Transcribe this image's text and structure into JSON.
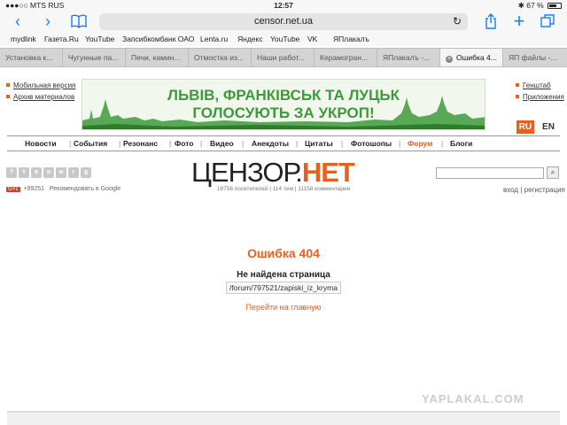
{
  "status": {
    "carrier": "●●●○○ MTS RUS",
    "time": "12:57",
    "bt": "✱",
    "battery_text": "67 %",
    "battery_level": 0.67
  },
  "browser": {
    "url": "censor.net.ua",
    "bookmarks": [
      "mydlink",
      "Газета.Ru",
      "YouTube",
      "Запсибкомбанк ОАО",
      "Lenta.ru",
      "Яндекс",
      "YouTube",
      "VK",
      "ЯПлакалъ"
    ],
    "tabs": [
      {
        "label": "Установка к..."
      },
      {
        "label": "Чугунные па..."
      },
      {
        "label": "Печи, камин..."
      },
      {
        "label": "Отмостка из..."
      },
      {
        "label": "Наши работ..."
      },
      {
        "label": "Керамогран..."
      },
      {
        "label": "ЯПлакалъ -..."
      },
      {
        "label": "Ошибка 4..."
      },
      {
        "label": "ЯП файлы -..."
      }
    ]
  },
  "site": {
    "mobile_version": "Мобильная версия",
    "archive": "Архив материалов",
    "genshtab": "Генштаб",
    "apps": "Приложения",
    "banner_line1": "ЛЬВІВ, ФРАНКІВСЬК ТА ЛУЦЬК",
    "banner_line2": "ГОЛОСУЮТЬ ЗА УКРОП!",
    "lang_ru": "RU",
    "lang_en": "EN",
    "nav": [
      "Новости",
      "События",
      "Резонанс",
      "Фото",
      "Видео",
      "Анекдоты",
      "Цитаты",
      "Фотошопы",
      "Форум",
      "Блоги"
    ],
    "logo_a": "ЦЕНЗОР.",
    "logo_b": "НЕТ",
    "stats": "16756 посетителей | 114 тем | 11158 комментария",
    "g1_label": "G+1",
    "g1_count": "+99251",
    "g1_text": "Рекомендовать в Google",
    "login": "вход",
    "register": "регистрация",
    "login_sep": "|"
  },
  "error": {
    "title": "Ошибка 404",
    "subtitle": "Не найдена страница",
    "path": "/forum/797521/zapiski_iz_kryma",
    "home_link": "Перейти на главную"
  },
  "watermark": "YAPLAKAL.COM",
  "colors": {
    "accent": "#e8601c",
    "ios_blue": "#1a7cff",
    "banner_green": "#3d9a3a"
  }
}
